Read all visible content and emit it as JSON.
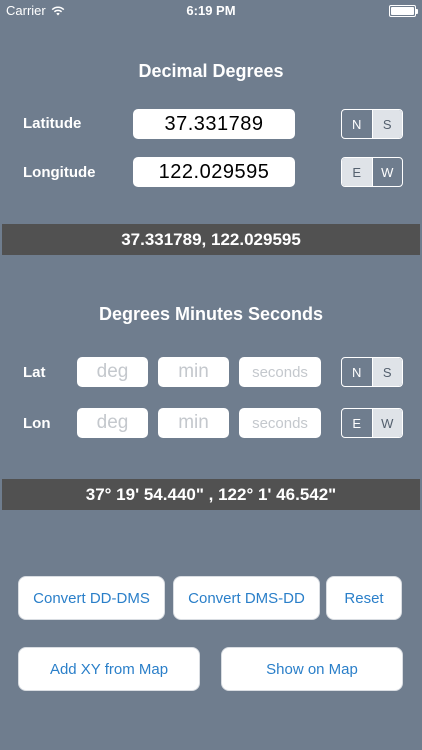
{
  "status_bar": {
    "carrier": "Carrier",
    "time": "6:19 PM"
  },
  "decimal_degrees": {
    "title": "Decimal Degrees",
    "latitude_label": "Latitude",
    "latitude_value": "37.331789",
    "longitude_label": "Longitude",
    "longitude_value": "122.029595",
    "lat_segment": {
      "options": [
        "N",
        "S"
      ],
      "selected": "S"
    },
    "lon_segment": {
      "options": [
        "E",
        "W"
      ],
      "selected": "E"
    },
    "result": "37.331789, 122.029595"
  },
  "dms": {
    "title": "Degrees Minutes Seconds",
    "lat_label": "Lat",
    "lon_label": "Lon",
    "placeholders": {
      "deg": "deg",
      "min": "min",
      "seconds": "seconds"
    },
    "lat_segment": {
      "options": [
        "N",
        "S"
      ],
      "selected": "S"
    },
    "lon_segment": {
      "options": [
        "E",
        "W"
      ],
      "selected": "W"
    },
    "result": "37° 19' 54.440\" , 122° 1' 46.542\""
  },
  "buttons": {
    "convert_dd_dms": "Convert DD-DMS",
    "convert_dms_dd": "Convert DMS-DD",
    "reset": "Reset",
    "add_xy": "Add XY from Map",
    "show_on_map": "Show on Map"
  },
  "colors": {
    "background": "#6f7d8e",
    "result_bar": "#515151",
    "button_text": "#2a7fc9",
    "segment_selected": "#dfe3e8"
  }
}
